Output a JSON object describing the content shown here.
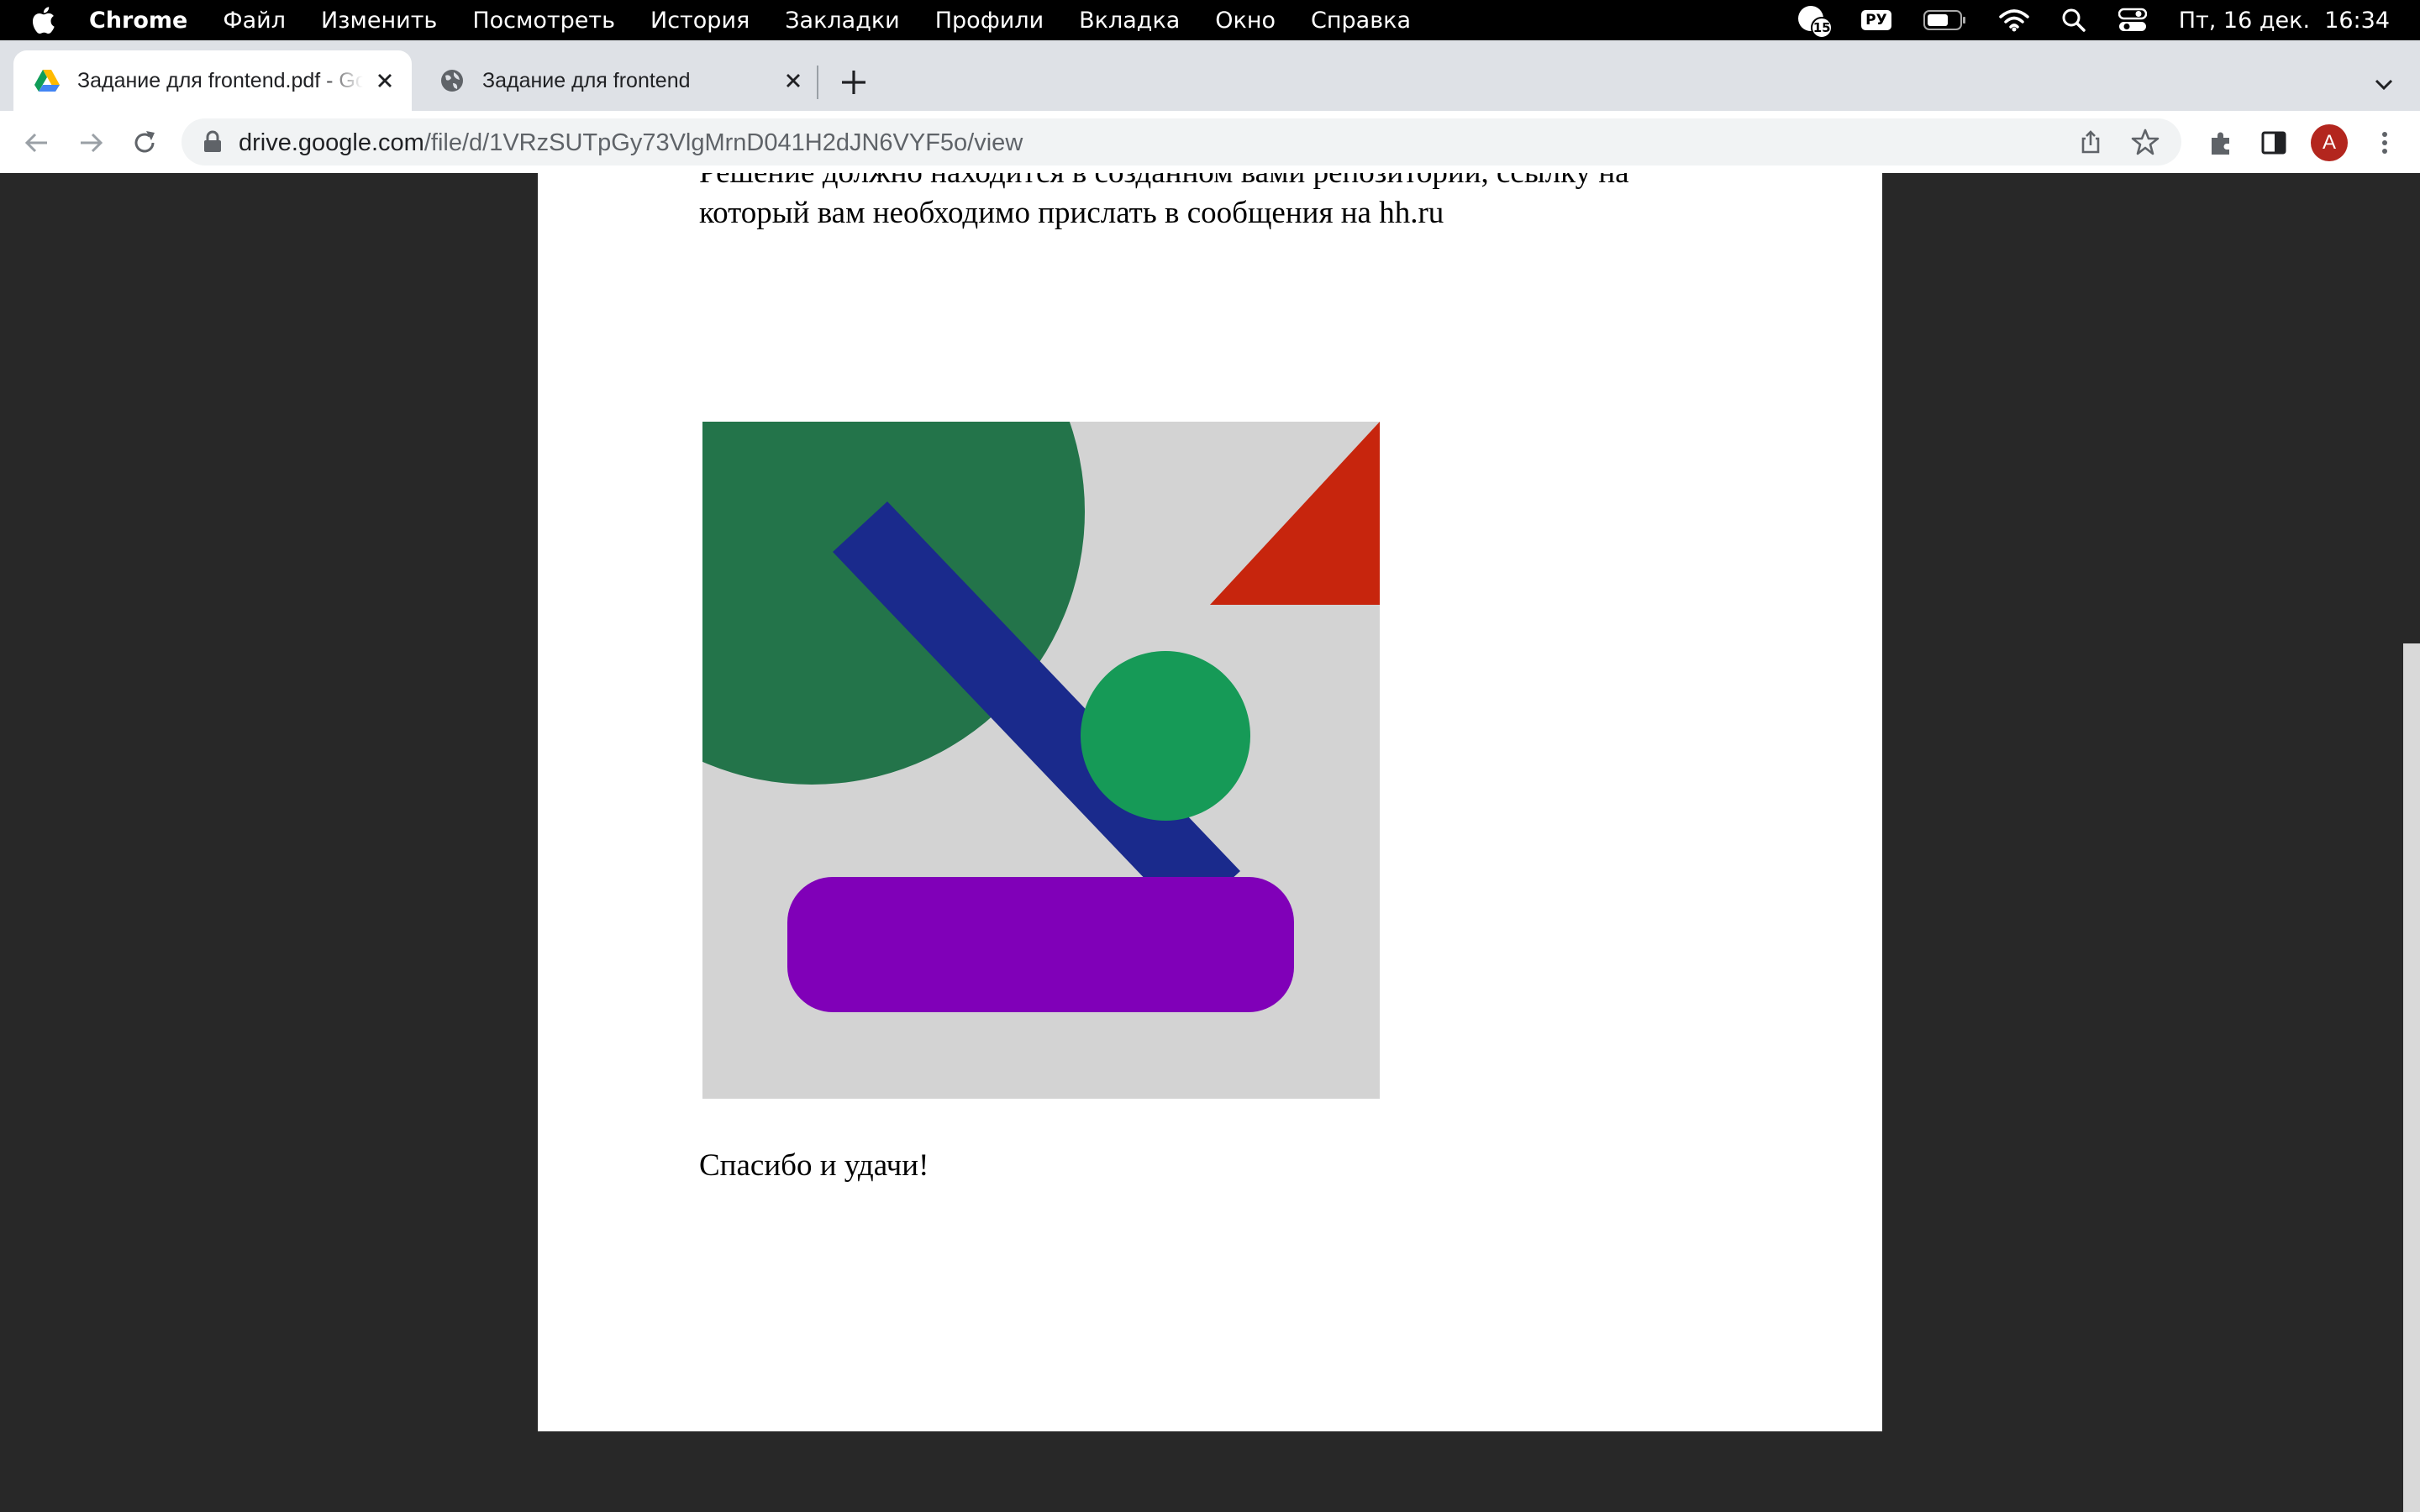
{
  "menubar": {
    "app_name": "Chrome",
    "menus": [
      "Файл",
      "Изменить",
      "Посмотреть",
      "История",
      "Закладки",
      "Профили",
      "Вкладка",
      "Окно",
      "Справка"
    ],
    "notification_count": "15",
    "input_language": "РУ",
    "datetime": "Пт, 16 дек.  16:34"
  },
  "tabs": [
    {
      "title": "Задание для frontend.pdf - Google Drive",
      "favicon": "google-drive-icon",
      "active": true
    },
    {
      "title": "Задание для frontend",
      "favicon": "globe-icon",
      "active": false
    }
  ],
  "omnibox": {
    "host": "drive.google.com",
    "path": "/file/d/1VRzSUTpGy73VlgMrnD041H2dJN6VYF5o/view"
  },
  "profile": {
    "initial": "A",
    "color": "#b3261e"
  },
  "document": {
    "paragraph_line1": "Решение должно находится в созданном вами репозитории, ссылку на",
    "paragraph_line2": "который вам необходимо прислать в сообщения на hh.ru",
    "closing": "Спасибо и удачи!"
  },
  "figure_colors": {
    "background": "#d3d3d3",
    "large_circle": "#23744a",
    "bar": "#1a2a8c",
    "small_circle": "#169a57",
    "triangle": "#c7250d",
    "rounded_rect": "#8000b8"
  }
}
